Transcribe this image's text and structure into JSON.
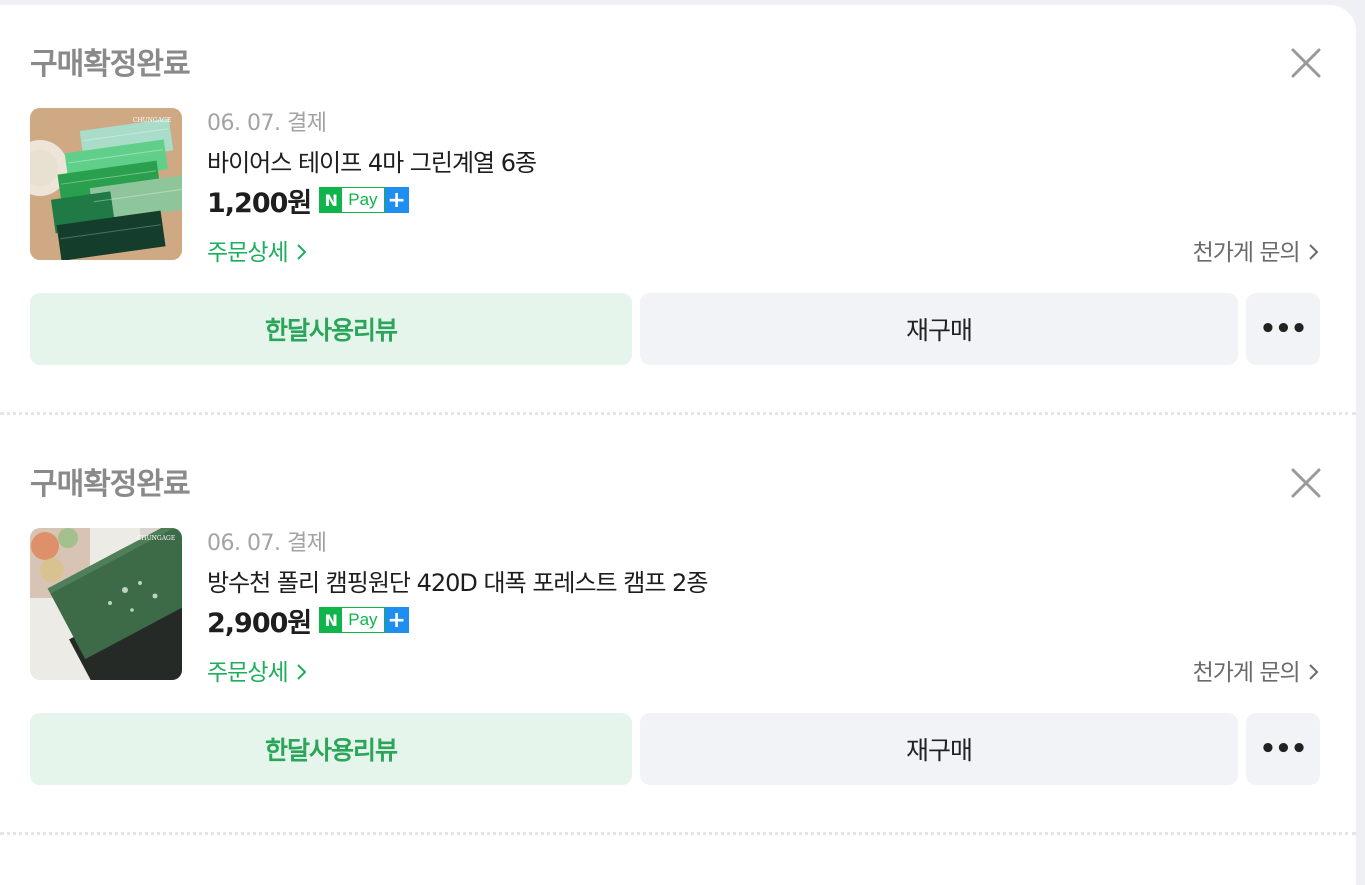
{
  "orders": [
    {
      "status": "구매확정완료",
      "pay_date": "06. 07. 결제",
      "product_name": "바이어스 테이프 4마 그린계열 6종",
      "price": "1,200원",
      "npay": {
        "n": "N",
        "label": "Pay",
        "plus": "+"
      },
      "detail_link": "주문상세",
      "inquiry_link": "천가게 문의",
      "thumb_brand": "CHUNGAGE",
      "buttons": {
        "review": "한달사용리뷰",
        "rebuy": "재구매",
        "more": "•••"
      }
    },
    {
      "status": "구매확정완료",
      "pay_date": "06. 07. 결제",
      "product_name": "방수천 폴리 캠핑원단 420D 대폭 포레스트 캠프 2종",
      "price": "2,900원",
      "npay": {
        "n": "N",
        "label": "Pay",
        "plus": "+"
      },
      "detail_link": "주문상세",
      "inquiry_link": "천가게 문의",
      "thumb_brand": "CHUNGAGE",
      "buttons": {
        "review": "한달사용리뷰",
        "rebuy": "재구매",
        "more": "•••"
      }
    }
  ],
  "icons": {
    "close": "close-icon",
    "chevron": "chevron-right-icon"
  },
  "colors": {
    "accent_green": "#1cae5a",
    "review_bg": "#e6f5ec",
    "npay_green": "#0fb54b",
    "npay_blue": "#1e8ef1",
    "status_gray": "#8a8a8a"
  }
}
